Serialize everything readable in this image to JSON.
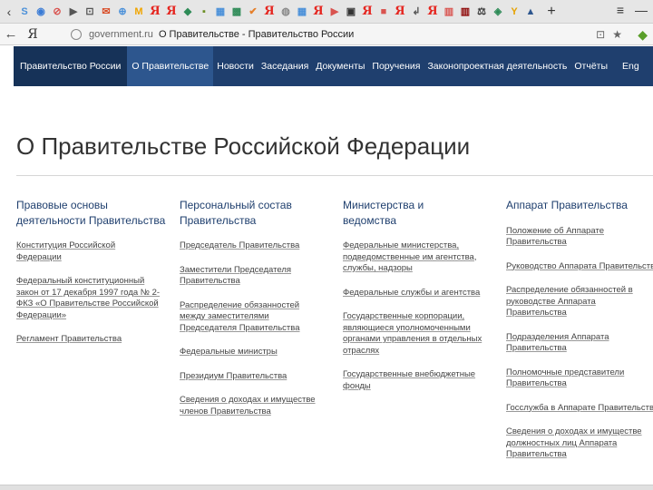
{
  "browser": {
    "favicons": [
      {
        "glyph": "S",
        "color": "#4a90d9"
      },
      {
        "glyph": "◉",
        "color": "#3a7bd5"
      },
      {
        "glyph": "⊘",
        "color": "#d9534f"
      },
      {
        "glyph": "▶",
        "color": "#555555"
      },
      {
        "glyph": "⊡",
        "color": "#555555"
      },
      {
        "glyph": "✉",
        "color": "#d84f2a"
      },
      {
        "glyph": "⊕",
        "color": "#4a90d9"
      },
      {
        "glyph": "M",
        "color": "#f0a500"
      },
      {
        "glyph": "Я",
        "color": "ya"
      },
      {
        "glyph": "Я",
        "color": "ya"
      },
      {
        "glyph": "◆",
        "color": "#2e8b57"
      },
      {
        "glyph": "▪",
        "color": "#6b8e23"
      },
      {
        "glyph": "▦",
        "color": "#4a90d9"
      },
      {
        "glyph": "▩",
        "color": "#2e8b57"
      },
      {
        "glyph": "✔",
        "color": "#e57f2a"
      },
      {
        "glyph": "Я",
        "color": "ya"
      },
      {
        "glyph": "◍",
        "color": "#888888"
      },
      {
        "glyph": "▦",
        "color": "#4a90d9"
      },
      {
        "glyph": "Я",
        "color": "ya"
      },
      {
        "glyph": "▶",
        "color": "#d9534f"
      },
      {
        "glyph": "▣",
        "color": "#333333"
      },
      {
        "glyph": "Я",
        "color": "ya"
      },
      {
        "glyph": "■",
        "color": "#d9534f"
      },
      {
        "glyph": "Я",
        "color": "ya"
      },
      {
        "glyph": "↲",
        "color": "#555555"
      },
      {
        "glyph": "Я",
        "color": "ya"
      },
      {
        "glyph": "▥",
        "color": "#d9534f"
      },
      {
        "glyph": "▥",
        "color": "#8b0000"
      },
      {
        "glyph": "⚖",
        "color": "#333333"
      },
      {
        "glyph": "◈",
        "color": "#2e8b57"
      },
      {
        "glyph": "Y",
        "color": "#e6a200"
      },
      {
        "glyph": "▲",
        "color": "#2d568e"
      }
    ],
    "plus": "+",
    "menu_icon": "≡",
    "minimize_icon": "—",
    "ya_logo": "Я",
    "url_domain": "government.ru",
    "url_title": "О Правительстве - Правительство России"
  },
  "nav": {
    "items": [
      "Правительство России",
      "О Правительстве",
      "Новости",
      "Заседания",
      "Документы",
      "Поручения",
      "Законопроектная деятельность",
      "Отчёты",
      "Eng"
    ]
  },
  "page": {
    "title": "О Правительстве Российской Федерации"
  },
  "columns": [
    {
      "head": "Правовые основы деятельности Правительства",
      "links": [
        "Конституция Российской Федерации",
        "Федеральный конституционный закон от 17 декабря 1997 года № 2-ФКЗ «О Правительстве Российской Федерации»",
        "Регламент Правительства"
      ]
    },
    {
      "head": "Персональный состав Правительства",
      "links": [
        "Председатель Правительства",
        "Заместители Председателя Правительства",
        "Распределение обязанностей между заместителями Председателя Правительства",
        "Федеральные министры",
        "Президиум Правительства",
        "Сведения о доходах и имуществе членов Правительства"
      ]
    },
    {
      "head": "Министерства и ведомства",
      "links": [
        "Федеральные министерства, подведомственные им агентства, службы, надзоры",
        "Федеральные службы и агентства",
        "Государственные корпорации, являющиеся уполномоченными органами управления в отдельных отраслях",
        "Государственные внебюджетные фонды"
      ]
    },
    {
      "head": "Аппарат Правительства",
      "links": [
        "Положение об Аппарате Правительства",
        "Руководство Аппарата Правительства",
        "Распределение обязанностей в руководстве Аппарата Правительства",
        "Подразделения Аппарата Правительства",
        "Полномочные представители Правительства",
        "Госслужба в Аппарате Правительства",
        "Сведения о доходах и имуществе должностных лиц Аппарата Правительства"
      ]
    }
  ]
}
